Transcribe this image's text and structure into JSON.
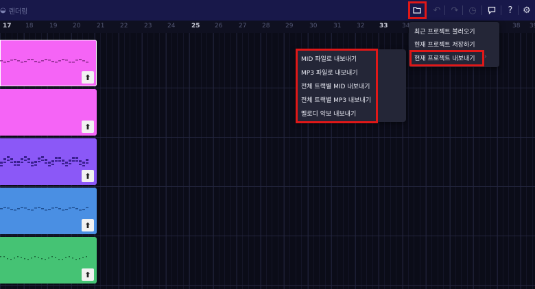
{
  "topbar": {
    "project_name": "렌더링",
    "icons": [
      "folder-icon",
      "undo-icon",
      "redo-icon",
      "history-icon",
      "feedback-icon",
      "help-icon",
      "settings-icon"
    ]
  },
  "ruler": {
    "bars": [
      "17",
      "18",
      "19",
      "20",
      "21",
      "22",
      "23",
      "24",
      "25",
      "26",
      "27",
      "28",
      "29",
      "30",
      "31",
      "32",
      "33",
      "34",
      "38",
      "39"
    ],
    "highlighted": [
      "17",
      "25",
      "33"
    ]
  },
  "tracks": [
    {
      "color": "#f564f6",
      "selected": true
    },
    {
      "color": "#f564f6",
      "selected": false
    },
    {
      "color": "#8b58f7",
      "selected": false
    },
    {
      "color": "#4a8fe3",
      "selected": false
    },
    {
      "color": "#45c374",
      "selected": false
    }
  ],
  "file_menu": {
    "items": [
      "최근 프로젝트 불러오기",
      "현재 프로젝트 저장하기",
      "현재 프로젝트 내보내기"
    ]
  },
  "export_submenu": {
    "items": [
      "MID 파일로 내보내기",
      "MP3 파일로 내보내기",
      "전체 트랙별 MID 내보내기",
      "전체 트랙별 MP3 내보내기",
      "멜로디 악보 내보내기"
    ]
  },
  "colors": {
    "highlight": "#e01818",
    "topbar": "#18184a",
    "menu": "#242637"
  }
}
